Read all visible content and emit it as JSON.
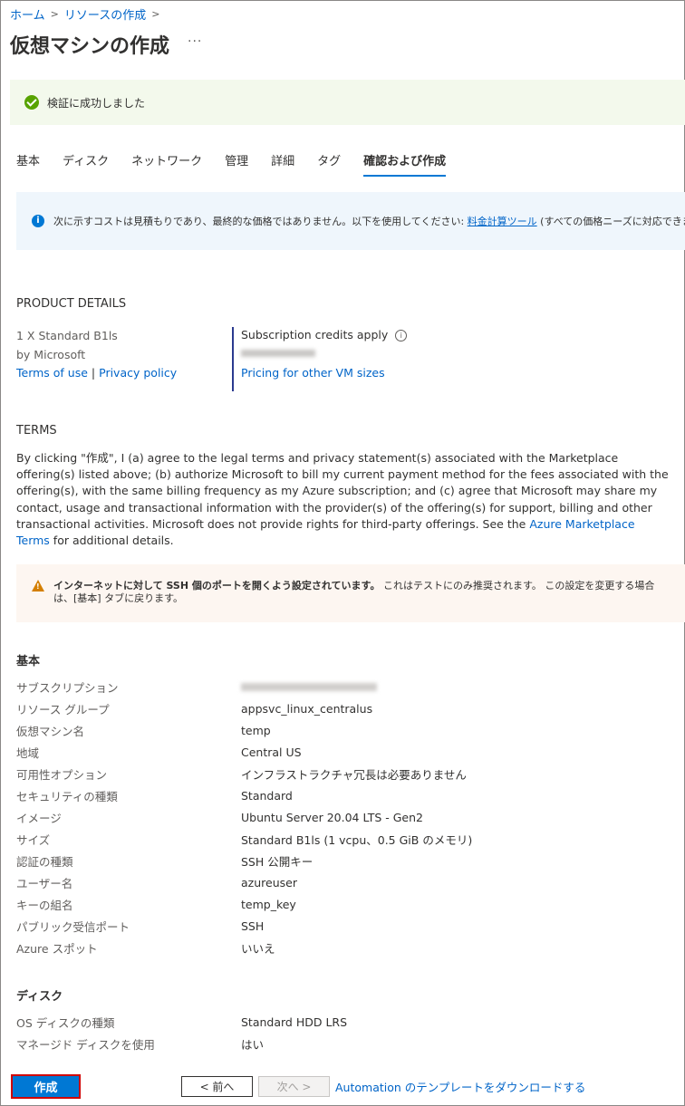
{
  "breadcrumb": {
    "home": "ホーム",
    "create": "リソースの作成"
  },
  "page_title": "仮想マシンの作成",
  "more_label": "···",
  "validation": {
    "text": "検証に成功しました"
  },
  "tabs": [
    {
      "label": "基本"
    },
    {
      "label": "ディスク"
    },
    {
      "label": "ネットワーク"
    },
    {
      "label": "管理"
    },
    {
      "label": "詳細"
    },
    {
      "label": "タグ"
    },
    {
      "label": "確認および作成"
    }
  ],
  "info": {
    "text": "次に示すコストは見積もりであり、最終的な価格ではありません。以下を使用してください:",
    "link": "料金計算ツール",
    "suffix": "(すべての価格ニーズに対応できます)。"
  },
  "product": {
    "heading": "PRODUCT DETAILS",
    "name": "1 X Standard B1ls",
    "by": "by Microsoft",
    "terms_link": "Terms of use",
    "separator": "|",
    "privacy_link": "Privacy policy",
    "credits": "Subscription credits apply",
    "pricing_link": "Pricing for other VM sizes"
  },
  "terms": {
    "heading": "TERMS",
    "body": "By clicking \"作成\", I (a) agree to the legal terms and privacy statement(s) associated with the Marketplace offering(s) listed above; (b) authorize Microsoft to bill my current payment method for the fees associated with the offering(s), with the same billing frequency as my Azure subscription; and (c) agree that Microsoft may share my contact, usage and transactional information with the provider(s) of the offering(s) for support, billing and other transactional activities. Microsoft does not provide rights for third-party offerings. See the",
    "link": "Azure Marketplace Terms",
    "tail": "for additional details."
  },
  "warning": {
    "bold": "インターネットに対して SSH 個のポートを開くよう設定されています。",
    "text": "これはテストにのみ推奨されます。 この設定を変更する場合は、[基本] タブに戻ります。"
  },
  "basics": {
    "heading": "基本",
    "rows": [
      {
        "k": "サブスクリプション",
        "v": ""
      },
      {
        "k": "リソース グループ",
        "v": "appsvc_linux_centralus"
      },
      {
        "k": "仮想マシン名",
        "v": "temp"
      },
      {
        "k": "地域",
        "v": "Central US"
      },
      {
        "k": "可用性オプション",
        "v": "インフラストラクチャ冗長は必要ありません"
      },
      {
        "k": "セキュリティの種類",
        "v": "Standard"
      },
      {
        "k": "イメージ",
        "v": "Ubuntu Server 20.04 LTS - Gen2"
      },
      {
        "k": "サイズ",
        "v": "Standard B1ls (1 vcpu、0.5 GiB のメモリ)"
      },
      {
        "k": "認証の種類",
        "v": "SSH 公開キー"
      },
      {
        "k": "ユーザー名",
        "v": "azureuser"
      },
      {
        "k": "キーの組名",
        "v": "temp_key"
      },
      {
        "k": "パブリック受信ポート",
        "v": "SSH"
      },
      {
        "k": "Azure スポット",
        "v": "いいえ"
      }
    ]
  },
  "disk": {
    "heading": "ディスク",
    "rows": [
      {
        "k": "OS ディスクの種類",
        "v": "Standard HDD LRS"
      },
      {
        "k": "マネージド ディスクを使用",
        "v": "はい"
      }
    ]
  },
  "footer": {
    "create": "作成",
    "prev": "< 前へ",
    "next": "次へ >",
    "automation": "Automation のテンプレートをダウンロードする"
  }
}
